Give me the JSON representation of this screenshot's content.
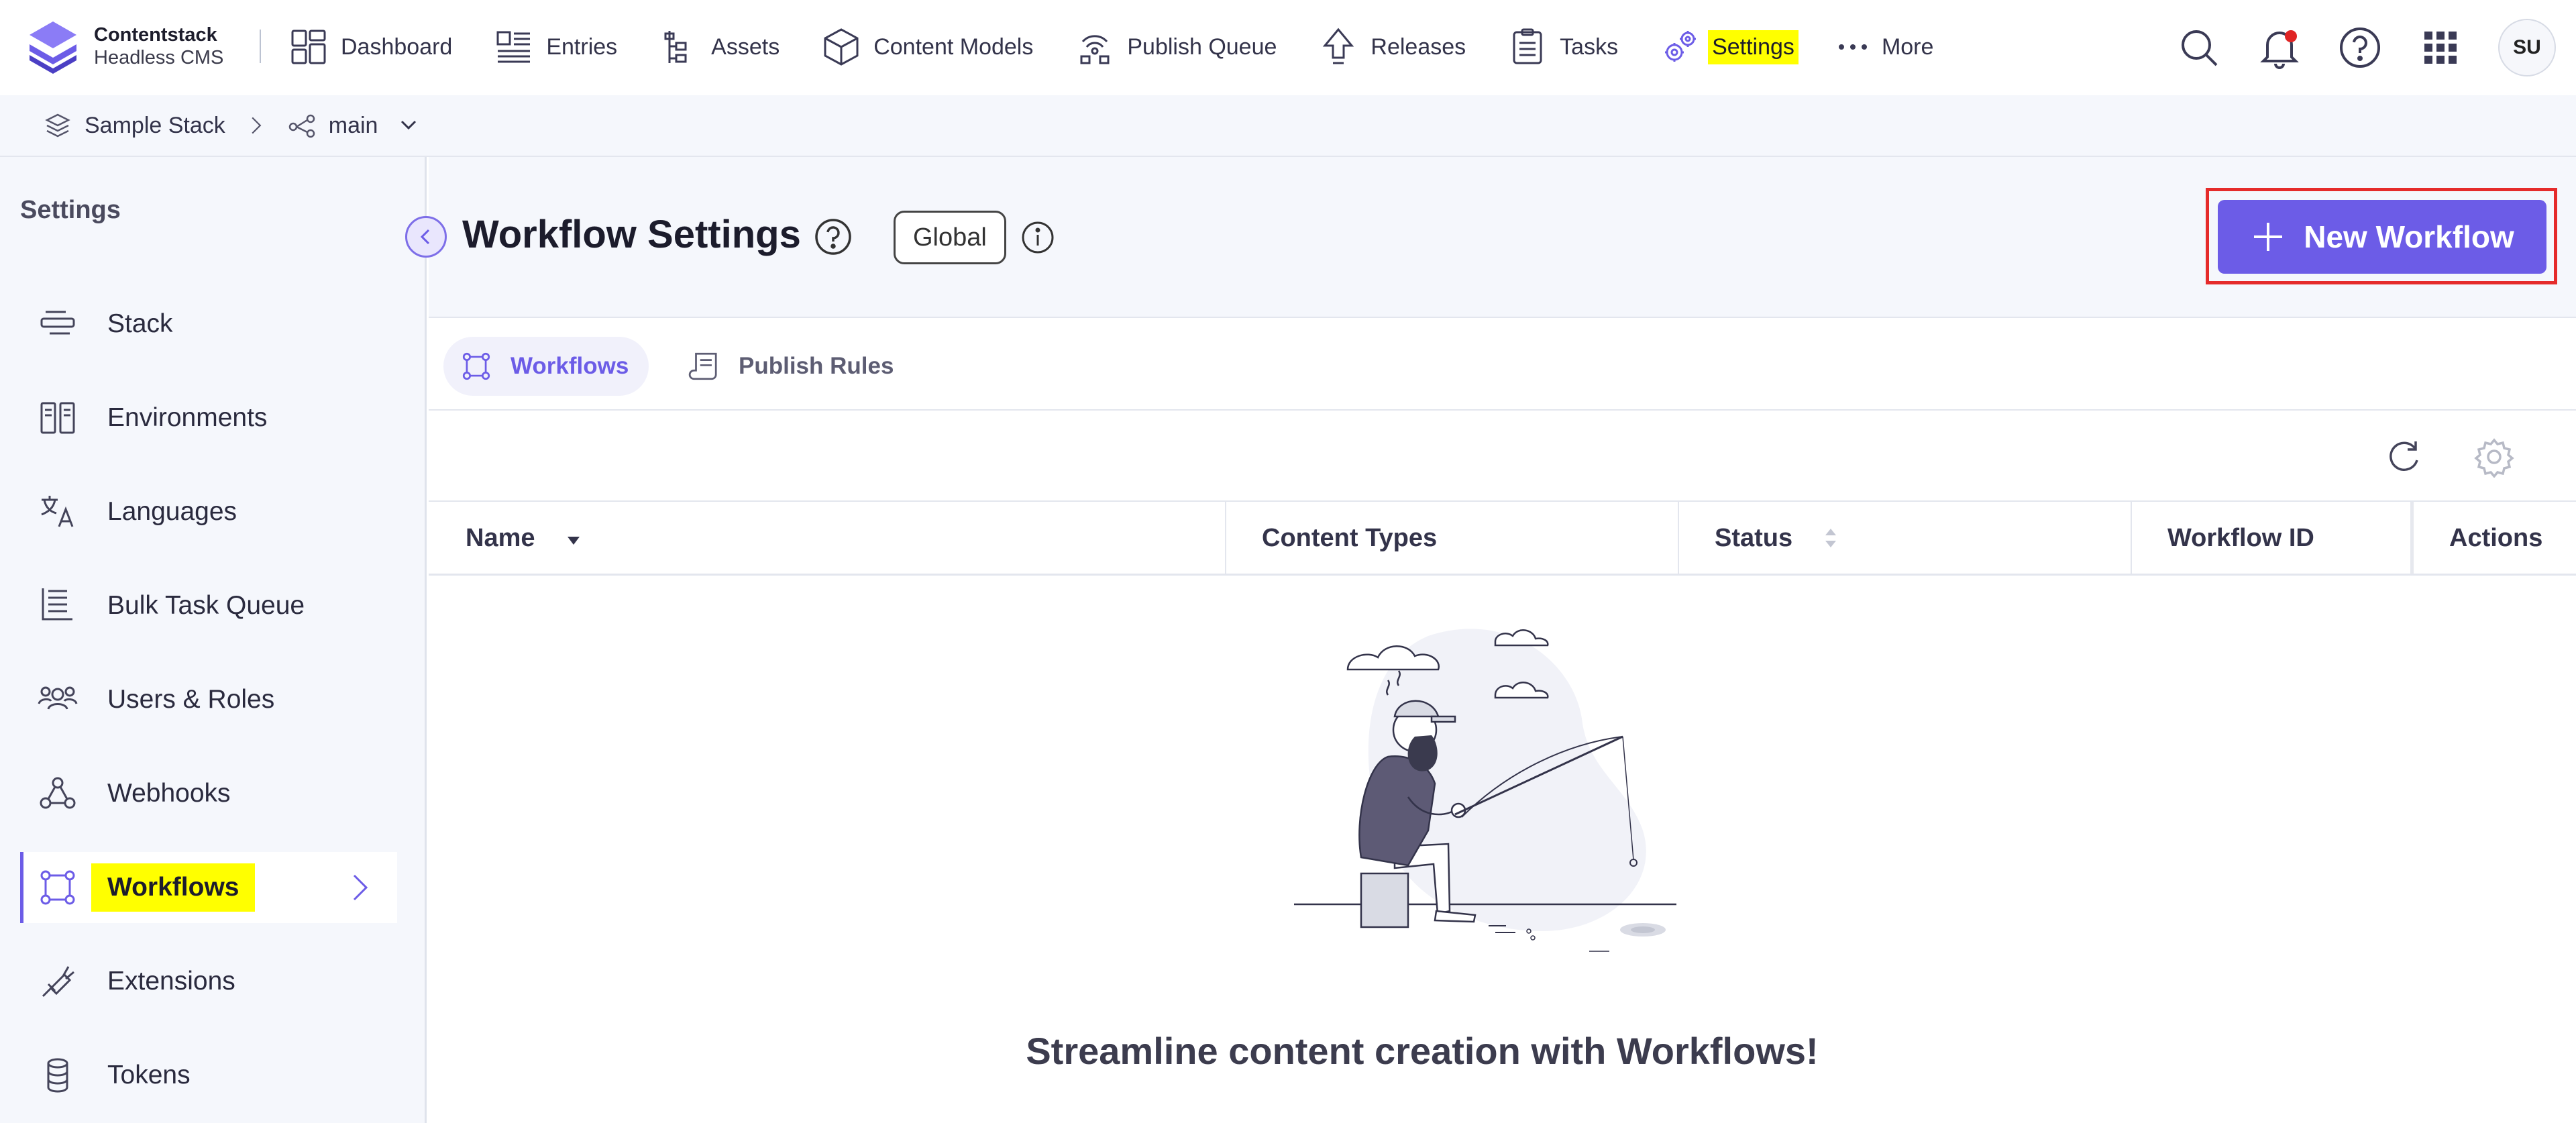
{
  "brand": {
    "name": "Contentstack",
    "product": "Headless CMS"
  },
  "nav": [
    {
      "label": "Dashboard",
      "icon": "dashboard-icon"
    },
    {
      "label": "Entries",
      "icon": "entries-icon"
    },
    {
      "label": "Assets",
      "icon": "assets-icon"
    },
    {
      "label": "Content Models",
      "icon": "content-models-icon"
    },
    {
      "label": "Publish Queue",
      "icon": "publish-queue-icon"
    },
    {
      "label": "Releases",
      "icon": "releases-icon"
    },
    {
      "label": "Tasks",
      "icon": "tasks-icon"
    },
    {
      "label": "Settings",
      "icon": "settings-icon",
      "highlighted": true
    },
    {
      "label": "More",
      "icon": "more-dots-icon"
    }
  ],
  "user": {
    "initials": "SU"
  },
  "breadcrumb": {
    "stack": "Sample Stack",
    "branch": "main"
  },
  "sidebar": {
    "title": "Settings",
    "items": [
      {
        "label": "Stack",
        "icon": "stack-icon"
      },
      {
        "label": "Environments",
        "icon": "environments-icon"
      },
      {
        "label": "Languages",
        "icon": "languages-icon"
      },
      {
        "label": "Bulk Task Queue",
        "icon": "bulk-task-queue-icon"
      },
      {
        "label": "Users & Roles",
        "icon": "users-roles-icon"
      },
      {
        "label": "Webhooks",
        "icon": "webhooks-icon"
      },
      {
        "label": "Workflows",
        "icon": "workflows-icon",
        "active": true
      },
      {
        "label": "Extensions",
        "icon": "extensions-icon"
      },
      {
        "label": "Tokens",
        "icon": "tokens-icon"
      }
    ]
  },
  "page": {
    "title": "Workflow Settings",
    "scope_badge": "Global",
    "new_button_label": "New Workflow"
  },
  "tabs": [
    {
      "label": "Workflows",
      "active": true
    },
    {
      "label": "Publish Rules",
      "active": false
    }
  ],
  "table": {
    "columns": [
      "Name",
      "Content Types",
      "Status",
      "Workflow ID",
      "Actions"
    ]
  },
  "empty_state": {
    "message": "Streamline content creation with Workflows!"
  },
  "colors": {
    "accent": "#6c5ce7",
    "highlight": "#ffff00",
    "callout": "#e52b2b",
    "sidebar_bg": "#f5f7fc"
  }
}
